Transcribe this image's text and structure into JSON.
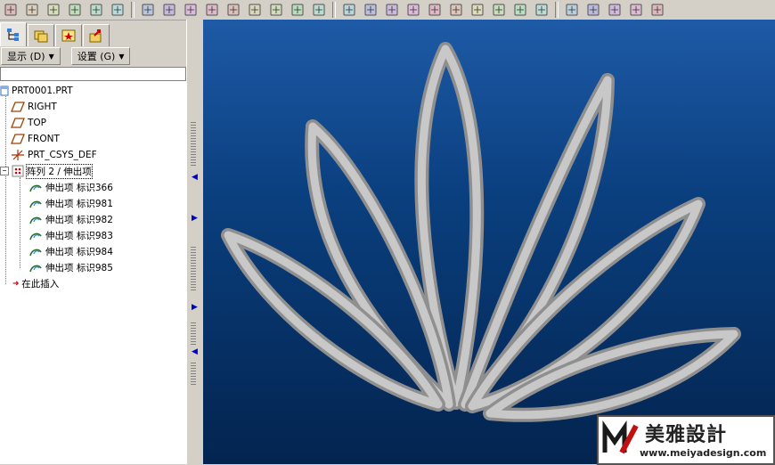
{
  "toolbar": {
    "icons": [
      "new-file-icon",
      "open-folder-icon",
      "save-icon",
      "print-icon",
      "send-icon",
      "erase-icon",
      "undo-icon",
      "redo-icon",
      "copy-icon",
      "paste-icon",
      "paste-special-icon",
      "regenerate-icon",
      "find-icon",
      "select-box-icon",
      "dropdown-icon",
      "repaint-icon",
      "spin-center-icon",
      "orient-icon",
      "zoom-in-icon",
      "zoom-out-icon",
      "refit-icon",
      "reorient-icon",
      "saved-views-icon",
      "layers-icon",
      "model-display-icon",
      "wireframe-icon",
      "hidden-line-icon",
      "no-hidden-icon",
      "shading-icon",
      "sketch-icon"
    ]
  },
  "tabs": [
    "model-tree-tab",
    "folder-browser-tab",
    "favorites-tab",
    "connections-tab"
  ],
  "menus": {
    "show_label": "显示 (D)",
    "settings_label": "设置 (G)"
  },
  "tree": {
    "root": "PRT0001.PRT",
    "datums": [
      "RIGHT",
      "TOP",
      "FRONT"
    ],
    "csys": "PRT_CSYS_DEF",
    "pattern": "阵列 2 / 伸出项",
    "features": [
      "伸出项 标识366",
      "伸出项 标识981",
      "伸出项 标识982",
      "伸出项 标识983",
      "伸出项 标识984",
      "伸出项 标识985"
    ],
    "insert_here": "在此插入"
  },
  "colors": {
    "viewport_top": "#1e5aa6",
    "viewport_bottom": "#03244f",
    "petal_light": "#c8c8c8",
    "petal_dark": "#8f8f8f"
  },
  "watermark": {
    "title": "美雅設計",
    "url": "www.meiyadesign.com"
  }
}
